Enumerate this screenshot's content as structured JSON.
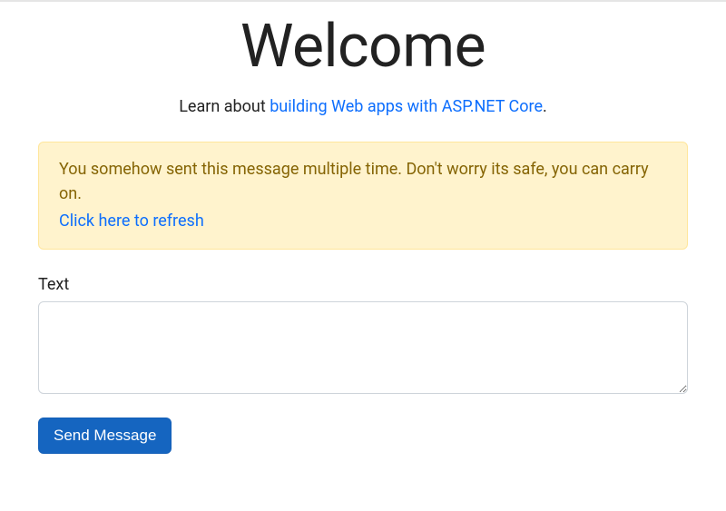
{
  "hero": {
    "title": "Welcome",
    "subtitle_prefix": "Learn about ",
    "subtitle_link": "building Web apps with ASP.NET Core",
    "subtitle_suffix": "."
  },
  "alert": {
    "message": "You somehow sent this message multiple time. Don't worry its safe, you can carry on.",
    "refresh_link": "Click here to refresh"
  },
  "form": {
    "text_label": "Text",
    "text_value": "",
    "submit_label": "Send Message"
  }
}
